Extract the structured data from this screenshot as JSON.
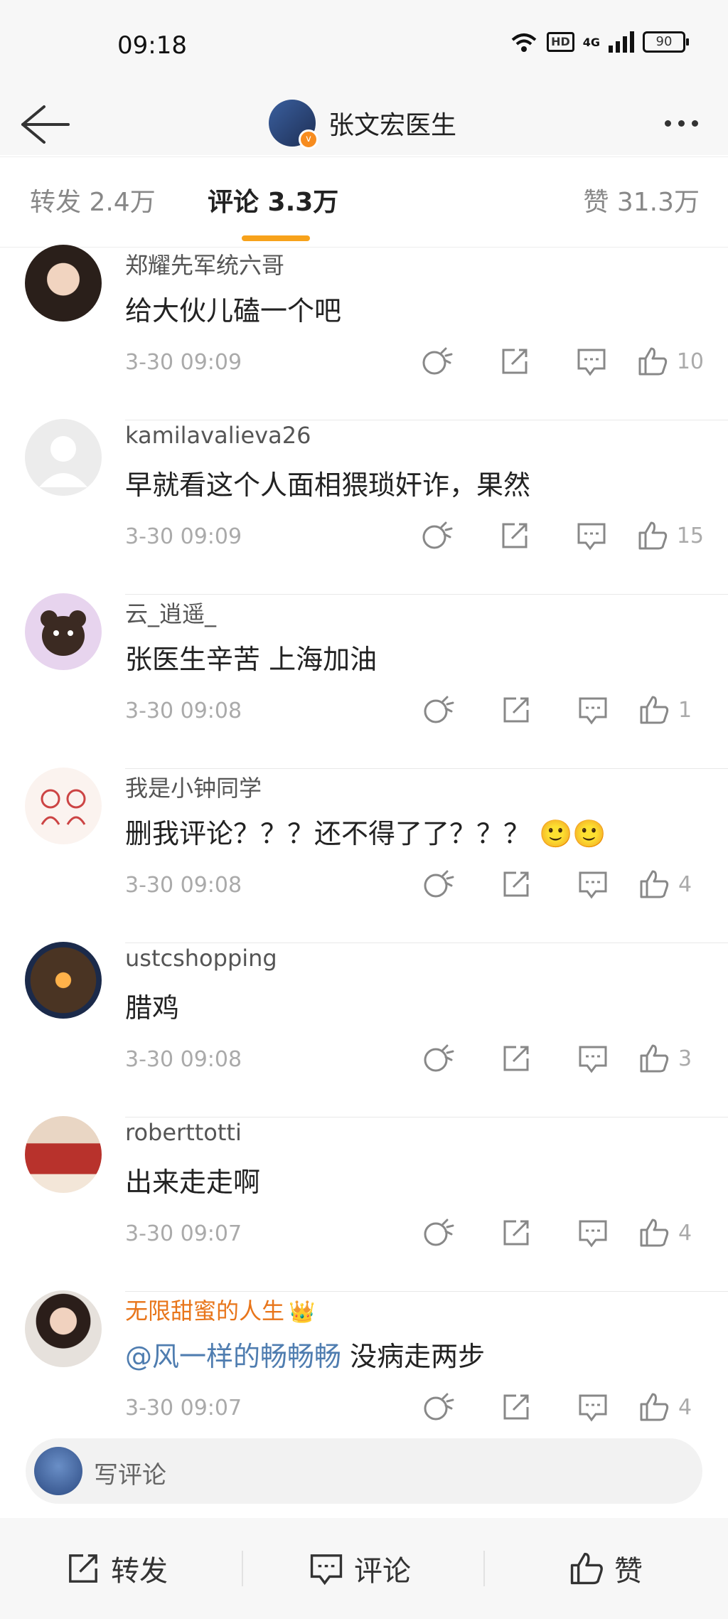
{
  "status_bar": {
    "time": "09:18",
    "hd": "HD",
    "network": "4G",
    "battery": "90"
  },
  "header": {
    "title": "张文宏医生",
    "verified_badge": "v"
  },
  "tabs": [
    {
      "label": "转发 2.4万"
    },
    {
      "label": "评论 3.3万"
    },
    {
      "label": "赞 31.3万"
    }
  ],
  "comments": [
    {
      "author": "郑耀先军统六哥",
      "text": "给大伙儿磕一个吧",
      "time": "3-30 09:09",
      "likes": "10"
    },
    {
      "author": "kamilavalieva26",
      "text": "早就看这个人面相猥琐奸诈，果然",
      "time": "3-30 09:09",
      "likes": "15"
    },
    {
      "author": "云_逍遥_",
      "text": "张医生辛苦 上海加油",
      "time": "3-30 09:08",
      "likes": "1"
    },
    {
      "author": "我是小钟同学",
      "text": "删我评论？？？还不得了了？？？",
      "emoji": "🙂🙂",
      "time": "3-30 09:08",
      "likes": "4"
    },
    {
      "author": "ustcshopping",
      "text": "腊鸡",
      "time": "3-30 09:08",
      "likes": "3"
    },
    {
      "author": "roberttotti",
      "text": "出来走走啊",
      "time": "3-30 09:07",
      "likes": "4"
    },
    {
      "author": "无限甜蜜的人生",
      "crown": "👑",
      "mention": "@风一样的畅畅畅",
      "text": " 没病走两步",
      "time": "3-30 09:07",
      "likes": "4"
    }
  ],
  "composer": {
    "placeholder": "写评论"
  },
  "bottom_bar": {
    "repost": "转发",
    "comment": "评论",
    "like": "赞"
  },
  "colors": {
    "accent": "#f7a21b",
    "vip_name": "#e8751a",
    "mention": "#4f7db0"
  }
}
